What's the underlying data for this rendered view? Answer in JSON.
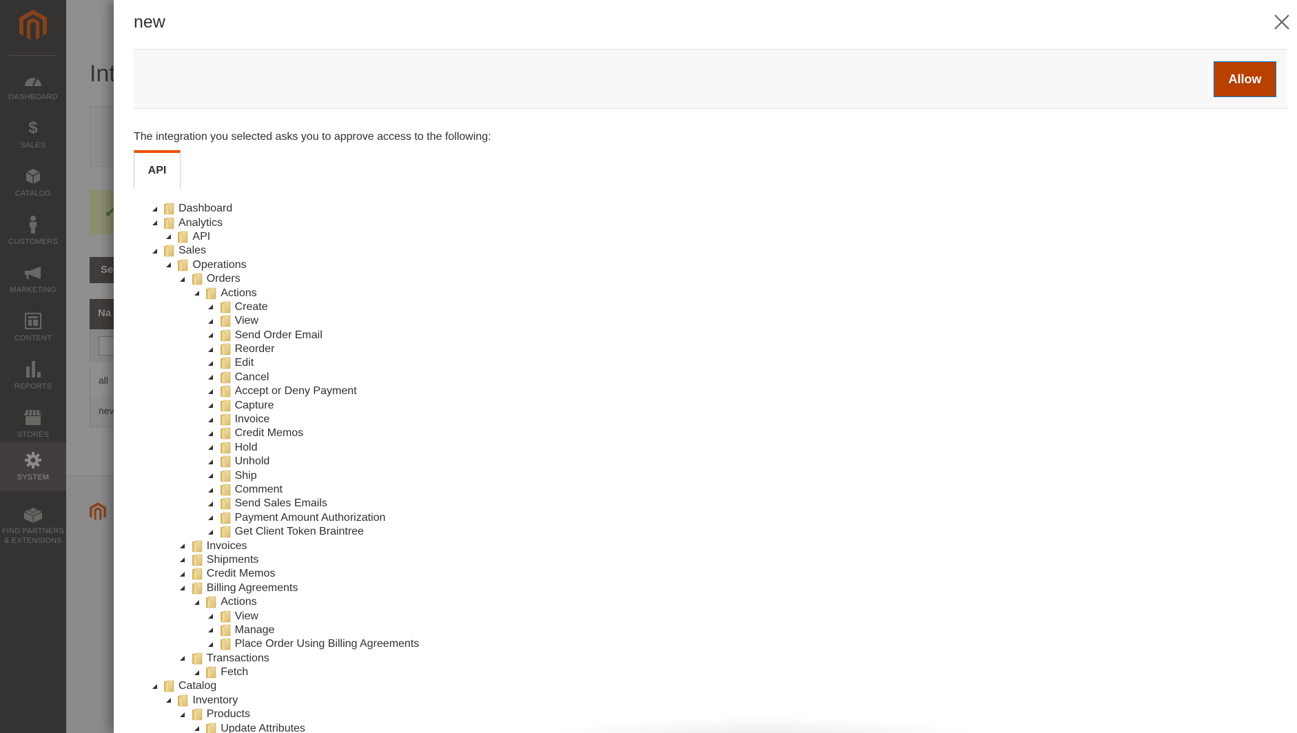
{
  "sidebar": {
    "logo": "magento-logo",
    "items": [
      {
        "label": "DASHBOARD",
        "icon": "dashboard-gauge-icon",
        "active": false
      },
      {
        "label": "SALES",
        "icon": "dollar-icon",
        "active": false
      },
      {
        "label": "CATALOG",
        "icon": "box-icon",
        "active": false
      },
      {
        "label": "CUSTOMERS",
        "icon": "person-icon",
        "active": false
      },
      {
        "label": "MARKETING",
        "icon": "megaphone-icon",
        "active": false
      },
      {
        "label": "CONTENT",
        "icon": "layout-icon",
        "active": false
      },
      {
        "label": "REPORTS",
        "icon": "bar-chart-icon",
        "active": false
      },
      {
        "label": "STORES",
        "icon": "storefront-icon",
        "active": false
      },
      {
        "label": "SYSTEM",
        "icon": "gear-icon",
        "active": true
      },
      {
        "label": "FIND PARTNERS & EXTENSIONS",
        "icon": "lego-brick-icon",
        "active": false
      }
    ]
  },
  "background_page": {
    "title": "Int",
    "button": "Se",
    "column_header": "Na",
    "rows": [
      "all",
      "nev"
    ]
  },
  "modal": {
    "title": "new",
    "close_icon": "close-icon",
    "allow_label": "Allow",
    "intro": "The integration you selected asks you to approve access to the following:",
    "tab_label": "API",
    "tree": [
      {
        "label": "Dashboard",
        "level": 0
      },
      {
        "label": "Analytics",
        "level": 0
      },
      {
        "label": "API",
        "level": 1
      },
      {
        "label": "Sales",
        "level": 0
      },
      {
        "label": "Operations",
        "level": 1
      },
      {
        "label": "Orders",
        "level": 2
      },
      {
        "label": "Actions",
        "level": 3
      },
      {
        "label": "Create",
        "level": 4
      },
      {
        "label": "View",
        "level": 4
      },
      {
        "label": "Send Order Email",
        "level": 4
      },
      {
        "label": "Reorder",
        "level": 4
      },
      {
        "label": "Edit",
        "level": 4
      },
      {
        "label": "Cancel",
        "level": 4
      },
      {
        "label": "Accept or Deny Payment",
        "level": 4
      },
      {
        "label": "Capture",
        "level": 4
      },
      {
        "label": "Invoice",
        "level": 4
      },
      {
        "label": "Credit Memos",
        "level": 4
      },
      {
        "label": "Hold",
        "level": 4
      },
      {
        "label": "Unhold",
        "level": 4
      },
      {
        "label": "Ship",
        "level": 4
      },
      {
        "label": "Comment",
        "level": 4
      },
      {
        "label": "Send Sales Emails",
        "level": 4
      },
      {
        "label": "Payment Amount Authorization",
        "level": 4
      },
      {
        "label": "Get Client Token Braintree",
        "level": 4
      },
      {
        "label": "Invoices",
        "level": 2
      },
      {
        "label": "Shipments",
        "level": 2
      },
      {
        "label": "Credit Memos",
        "level": 2
      },
      {
        "label": "Billing Agreements",
        "level": 2
      },
      {
        "label": "Actions",
        "level": 3
      },
      {
        "label": "View",
        "level": 4
      },
      {
        "label": "Manage",
        "level": 4
      },
      {
        "label": "Place Order Using Billing Agreements",
        "level": 4
      },
      {
        "label": "Transactions",
        "level": 2
      },
      {
        "label": "Fetch",
        "level": 3
      },
      {
        "label": "Catalog",
        "level": 0
      },
      {
        "label": "Inventory",
        "level": 1
      },
      {
        "label": "Products",
        "level": 2
      },
      {
        "label": "Update Attributes",
        "level": 3
      }
    ]
  },
  "colors": {
    "accent": "#eb5202",
    "allow_button": "#ba4000",
    "sidebar_bg": "#373330",
    "sidebar_active": "#524d49"
  }
}
